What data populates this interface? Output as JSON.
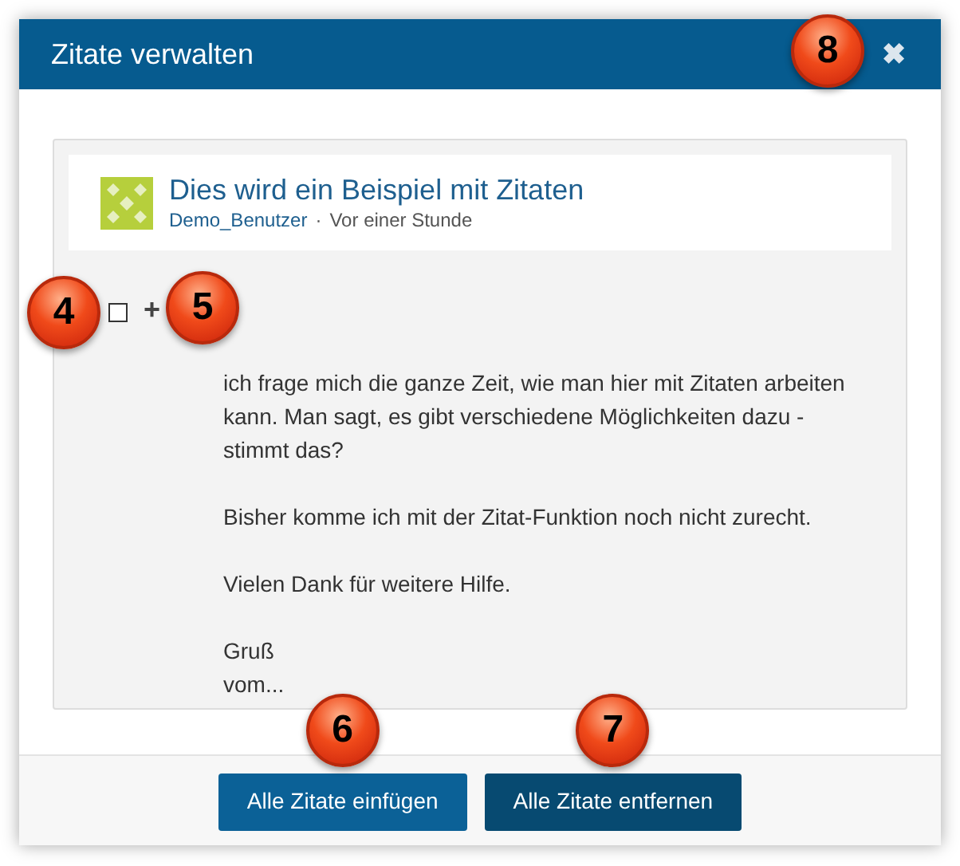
{
  "dialog": {
    "title": "Zitate verwalten",
    "close": "✖",
    "callout": "8"
  },
  "post": {
    "title": "Dies wird ein Beispiel mit Zitaten",
    "author": "Demo_Benutzer",
    "separator": "·",
    "time": "Vor einer Stunde"
  },
  "quote_controls": {
    "checked": false,
    "checkbox_callout": "4",
    "add": "+",
    "add_callout": "5"
  },
  "message": [
    "ich frage mich die ganze Zeit, wie man hier mit Zitaten arbeiten kann. Man sagt, es gibt verschiedene Möglichkeiten dazu - stimmt das?",
    "Bisher komme ich mit der Zitat-Funktion noch nicht zurecht.",
    "Vielen Dank für weitere Hilfe.",
    "Gruß\nvom..."
  ],
  "buttons": [
    {
      "label": "Alle Zitate einfügen",
      "kind": "primary",
      "callout": "6"
    },
    {
      "label": "Alle Zitate entfernen",
      "kind": "dark",
      "callout": "7"
    }
  ]
}
